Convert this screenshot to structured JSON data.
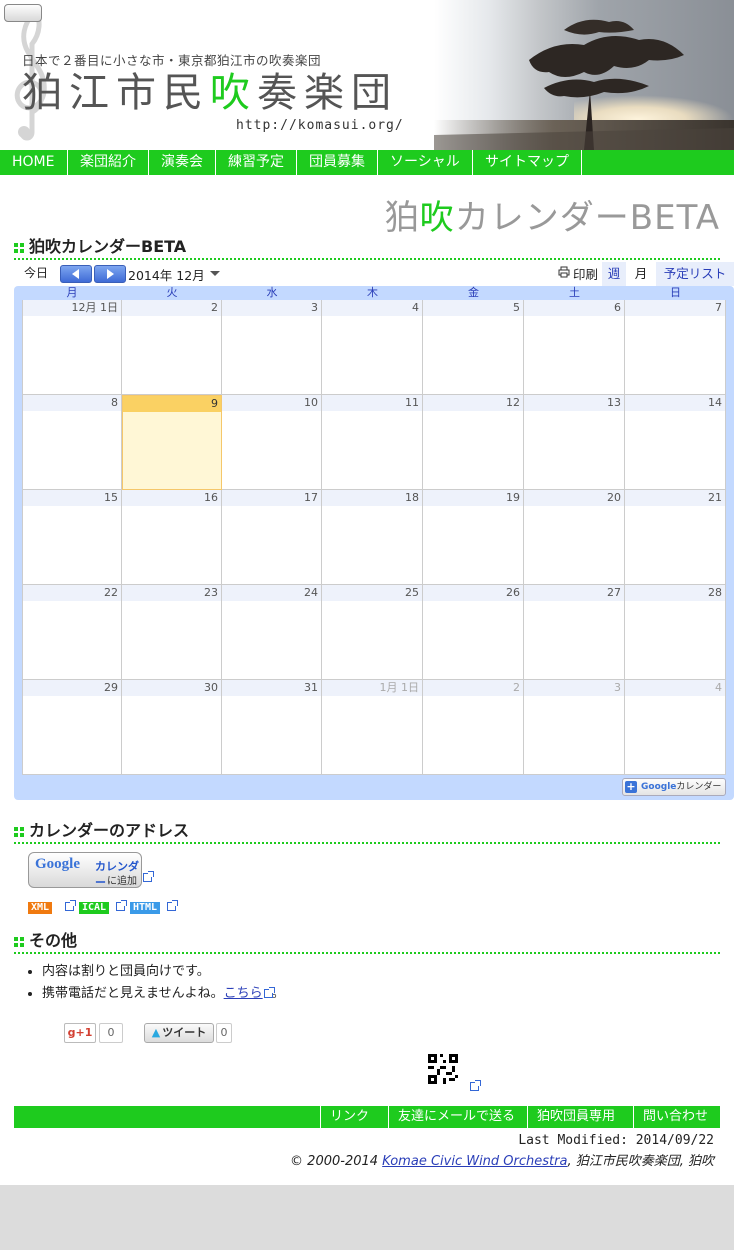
{
  "header": {
    "tagline": "日本で２番目に小さな市・東京都狛江市の吹奏楽団",
    "title_pre": "狛江市民",
    "title_green": "吹",
    "title_post": "奏楽団",
    "url": "http://komasui.org/"
  },
  "nav": {
    "items": [
      "HOME",
      "楽団紹介",
      "演奏会",
      "練習予定",
      "団員募集",
      "ソーシャル",
      "サイトマップ"
    ]
  },
  "page_heading": {
    "pre": "狛",
    "green": "吹",
    "post": "カレンダーBETA"
  },
  "sections": {
    "calendar": "狛吹カレンダーBETA",
    "address": "カレンダーのアドレス",
    "other": "その他"
  },
  "calendar": {
    "today_label": "今日",
    "month_label": "2014年 12月",
    "print_label": "印刷",
    "tabs": {
      "week": "週",
      "month": "月",
      "agenda": "予定リスト"
    },
    "weekdays": [
      "月",
      "火",
      "水",
      "木",
      "金",
      "土",
      "日"
    ],
    "weeks": [
      [
        {
          "d": "12月 1日",
          "o": false
        },
        {
          "d": "2",
          "o": false
        },
        {
          "d": "3",
          "o": false
        },
        {
          "d": "4",
          "o": false
        },
        {
          "d": "5",
          "o": false
        },
        {
          "d": "6",
          "o": false
        },
        {
          "d": "7",
          "o": false
        }
      ],
      [
        {
          "d": "8",
          "o": false
        },
        {
          "d": "9",
          "o": false,
          "today": true
        },
        {
          "d": "10",
          "o": false
        },
        {
          "d": "11",
          "o": false
        },
        {
          "d": "12",
          "o": false
        },
        {
          "d": "13",
          "o": false
        },
        {
          "d": "14",
          "o": false
        }
      ],
      [
        {
          "d": "15",
          "o": false
        },
        {
          "d": "16",
          "o": false
        },
        {
          "d": "17",
          "o": false
        },
        {
          "d": "18",
          "o": false
        },
        {
          "d": "19",
          "o": false
        },
        {
          "d": "20",
          "o": false
        },
        {
          "d": "21",
          "o": false
        }
      ],
      [
        {
          "d": "22",
          "o": false
        },
        {
          "d": "23",
          "o": false
        },
        {
          "d": "24",
          "o": false
        },
        {
          "d": "25",
          "o": false
        },
        {
          "d": "26",
          "o": false
        },
        {
          "d": "27",
          "o": false
        },
        {
          "d": "28",
          "o": false
        }
      ],
      [
        {
          "d": "29",
          "o": false
        },
        {
          "d": "30",
          "o": false
        },
        {
          "d": "31",
          "o": false
        },
        {
          "d": "1月 1日",
          "o": true
        },
        {
          "d": "2",
          "o": true
        },
        {
          "d": "3",
          "o": true
        },
        {
          "d": "4",
          "o": true
        }
      ]
    ],
    "badge_google": "Google",
    "badge_label": "カレンダー"
  },
  "address": {
    "add_google": "Google",
    "add_cal": "カレンダー",
    "add_suffix": "に追加",
    "feeds": [
      {
        "label": "XML",
        "color": "#f07a10"
      },
      {
        "label": "ICAL",
        "color": "#1ecb1e"
      },
      {
        "label": "HTML",
        "color": "#3a9ae8"
      }
    ]
  },
  "other": {
    "item1": "内容は割りと団員向けです。",
    "item2_pre": "携帯電話だと見えませんよね。",
    "item2_link": "こちら",
    "item2_post": "。"
  },
  "social": {
    "gplus_label": "+1",
    "gplus_count": "0",
    "tweet_label": "ツイート",
    "tweet_count": "0"
  },
  "footer": {
    "links": [
      "リンク",
      "友達にメールで送る",
      "狛吹団員専用",
      "問い合わせ"
    ],
    "last_modified": "Last Modified: 2014/09/22",
    "copyright_pre": "© 2000-2014 ",
    "copyright_link": "Komae Civic Wind Orchestra",
    "copyright_post": ", 狛江市民吹奏楽団, 狛吹"
  },
  "colors": {
    "brand_green": "#1ecb1e",
    "calendar_blue": "#c3d9ff",
    "today": "#fad163"
  }
}
